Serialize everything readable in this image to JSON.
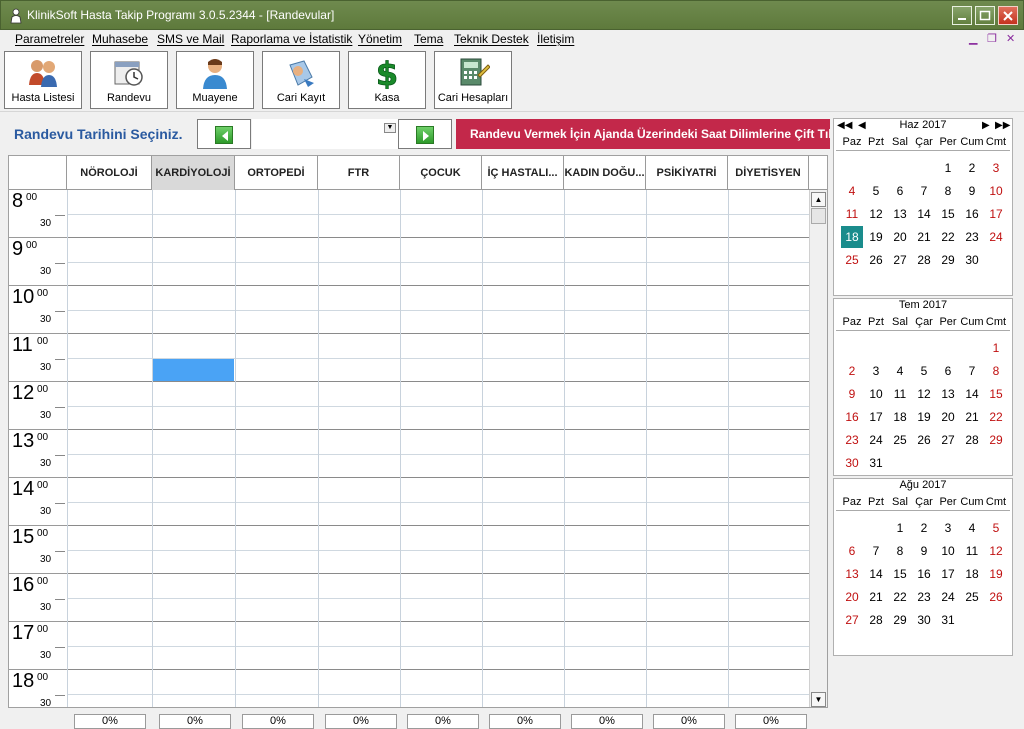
{
  "window": {
    "title": "KlinikSoft Hasta Takip Programı  3.0.5.2344 - [Randevular]"
  },
  "menu": [
    "Parametreler",
    "Muhasebe",
    "SMS ve Mail",
    "Raporlama ve İstatistik",
    "Yönetim",
    "Tema",
    "Teknik Destek",
    "İletişim"
  ],
  "toolbar": [
    {
      "label": "Hasta Listesi",
      "icon": "patients-icon"
    },
    {
      "label": "Randevu",
      "icon": "appointment-icon"
    },
    {
      "label": "Muayene",
      "icon": "doctor-icon"
    },
    {
      "label": "Cari Kayıt",
      "icon": "account-record-icon"
    },
    {
      "label": "Kasa",
      "icon": "dollar-icon"
    },
    {
      "label": "Cari Hesapları",
      "icon": "calculator-icon"
    }
  ],
  "date_selector": {
    "label": "Randevu Tarihini Seçiniz.",
    "banner": "Randevu Vermek İçin Ajanda Üzerindeki Saat Dilimlerine Çift Tık"
  },
  "columns": [
    "NÖROLOJİ",
    "KARDİYOLOJİ",
    "ORTOPEDİ",
    "FTR",
    "ÇOCUK",
    "İÇ HASTALI...",
    "KADIN DOĞU...",
    "PSİKİYATRİ",
    "DİYETİSYEN"
  ],
  "active_column": "KARDİYOLOJİ",
  "hours": [
    "8",
    "9",
    "10",
    "11",
    "12",
    "13",
    "14",
    "15",
    "16",
    "17",
    "18"
  ],
  "minutes": {
    "top": "00",
    "half": "30"
  },
  "footer_percents": [
    "0%",
    "0%",
    "0%",
    "0%",
    "0%",
    "0%",
    "0%",
    "0%",
    "0%"
  ],
  "calendars": [
    {
      "title": "Haz 2017",
      "dow": [
        "Paz",
        "Pzt",
        "Sal",
        "Çar",
        "Per",
        "Cum",
        "Cmt"
      ],
      "weeks": [
        [
          "",
          "",
          "",
          "",
          "1",
          "2",
          "3"
        ],
        [
          "4",
          "5",
          "6",
          "7",
          "8",
          "9",
          "10"
        ],
        [
          "11",
          "12",
          "13",
          "14",
          "15",
          "16",
          "17"
        ],
        [
          "18",
          "19",
          "20",
          "21",
          "22",
          "23",
          "24"
        ],
        [
          "25",
          "26",
          "27",
          "28",
          "29",
          "30",
          ""
        ]
      ],
      "today": "18"
    },
    {
      "title": "Tem 2017",
      "dow": [
        "Paz",
        "Pzt",
        "Sal",
        "Çar",
        "Per",
        "Cum",
        "Cmt"
      ],
      "weeks": [
        [
          "",
          "",
          "",
          "",
          "",
          "",
          "1"
        ],
        [
          "2",
          "3",
          "4",
          "5",
          "6",
          "7",
          "8"
        ],
        [
          "9",
          "10",
          "11",
          "12",
          "13",
          "14",
          "15"
        ],
        [
          "16",
          "17",
          "18",
          "19",
          "20",
          "21",
          "22"
        ],
        [
          "23",
          "24",
          "25",
          "26",
          "27",
          "28",
          "29"
        ],
        [
          "30",
          "31",
          "",
          "",
          "",
          "",
          ""
        ]
      ]
    },
    {
      "title": "Ağu 2017",
      "dow": [
        "Paz",
        "Pzt",
        "Sal",
        "Çar",
        "Per",
        "Cum",
        "Cmt"
      ],
      "weeks": [
        [
          "",
          "",
          "1",
          "2",
          "3",
          "4",
          "5"
        ],
        [
          "6",
          "7",
          "8",
          "9",
          "10",
          "11",
          "12"
        ],
        [
          "13",
          "14",
          "15",
          "16",
          "17",
          "18",
          "19"
        ],
        [
          "20",
          "21",
          "22",
          "23",
          "24",
          "25",
          "26"
        ],
        [
          "27",
          "28",
          "29",
          "30",
          "31",
          "",
          ""
        ]
      ]
    }
  ],
  "colors": {
    "titlebar": "#6f8a4e",
    "banner": "#c3284a",
    "selected_slot": "#4aa3f5",
    "today": "#1a8c8c",
    "weekend": "#c01010",
    "label_blue": "#2a5aa0"
  }
}
